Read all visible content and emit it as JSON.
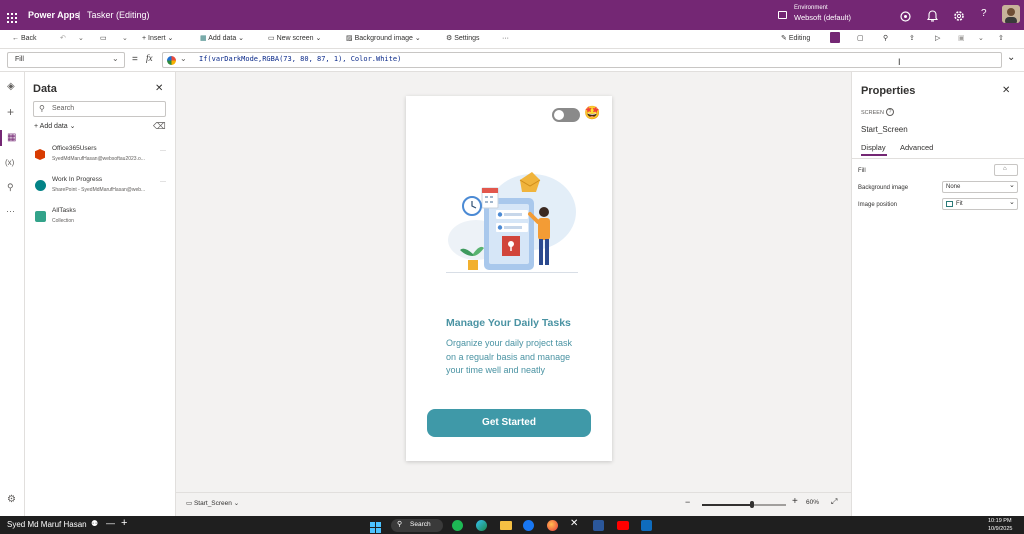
{
  "topbar": {
    "app": "Power Apps",
    "separator": "|",
    "doc": "Tasker (Editing)",
    "env_label": "Environment",
    "env_value": "Websoft (default)"
  },
  "toolbar": {
    "back": "Back",
    "insert": "Insert",
    "add_data": "Add data",
    "new_screen": "New screen",
    "background_image": "Background image",
    "settings": "Settings",
    "more": "···",
    "editing": "Editing"
  },
  "formula": {
    "property": "Fill",
    "equals": "=",
    "fx": "fx",
    "expression": "If(varDarkMode,RGBA(73, 80, 87, 1), Color.White)"
  },
  "data_panel": {
    "title": "Data",
    "search_placeholder": "Search",
    "add_data": "Add data",
    "items": [
      {
        "name": "Office365Users",
        "sub": "SyedMdMarufHasan@websoftau2023.o..."
      },
      {
        "name": "Work In Progress",
        "sub": "SharePoint - SyedMdMarufHasan@web..."
      },
      {
        "name": "AllTasks",
        "sub": "Collection"
      }
    ]
  },
  "app": {
    "heading": "Manage Your Daily Tasks",
    "body": "Organize your daily project task on a regualr basis and manage your time well and neatly",
    "button": "Get Started",
    "emoji": "🤩"
  },
  "properties": {
    "title": "Properties",
    "type_label": "SCREEN",
    "screen_name": "Start_Screen",
    "tabs": [
      "Display",
      "Advanced"
    ],
    "fill_label": "Fill",
    "bg_image_label": "Background image",
    "bg_image_value": "None",
    "img_pos_label": "Image position",
    "img_pos_value": "Fit"
  },
  "bottom": {
    "screen": "Start_Screen",
    "zoom": "60%",
    "zoom_level": 0.6
  },
  "taskbar": {
    "user": "Syed Md Maruf Hasan",
    "search": "Search",
    "time": "10:19 PM",
    "date": "10/9/2025"
  },
  "colors": {
    "purple": "#742774",
    "teal": "#3f99a8",
    "teal_text": "#4a93a3"
  }
}
